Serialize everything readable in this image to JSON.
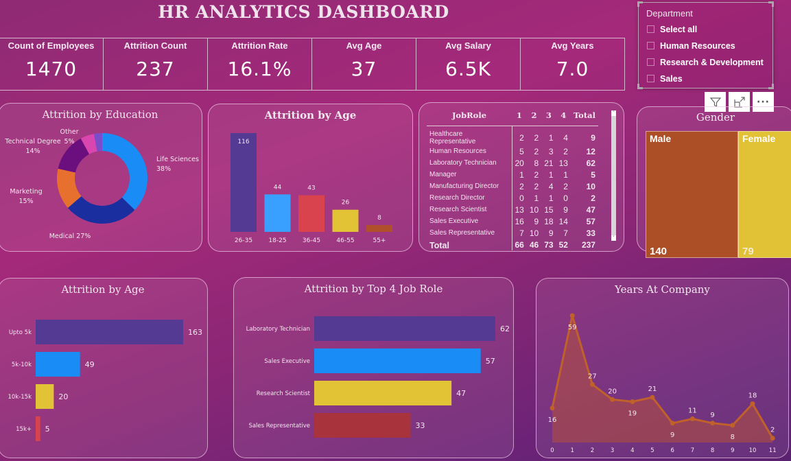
{
  "header": {
    "title": "HR ANALYTICS DASHBOARD"
  },
  "kpis": [
    {
      "label": "Count of Employees",
      "value": "1470"
    },
    {
      "label": "Attrition Count",
      "value": "237"
    },
    {
      "label": "Attrition Rate",
      "value": "16.1%"
    },
    {
      "label": "Avg Age",
      "value": "37"
    },
    {
      "label": "Avg Salary",
      "value": "6.5K"
    },
    {
      "label": "Avg Years",
      "value": "7.0"
    }
  ],
  "slicer": {
    "title": "Department",
    "options": [
      {
        "label": "Select all",
        "checked": false
      },
      {
        "label": "Human Resources",
        "checked": false
      },
      {
        "label": "Research & Development",
        "checked": false
      },
      {
        "label": "Sales",
        "checked": false
      }
    ],
    "header_icons": [
      "filter-icon",
      "focus-mode-icon",
      "more-options-icon"
    ],
    "more_label": "···"
  },
  "education": {
    "title": "Attrition by Education",
    "chart_data": {
      "type": "pie",
      "title": "Attrition by Education",
      "slices": [
        {
          "label": "Life Sciences",
          "percent": 38,
          "color": "#1a8cf5",
          "display": "Life Sciences\n38%"
        },
        {
          "label": "Medical",
          "percent": 27,
          "color": "#1b2ea0",
          "display": "Medical 27%"
        },
        {
          "label": "Marketing",
          "percent": 15,
          "color": "#e8702f",
          "display": "Marketing\n15%"
        },
        {
          "label": "Technical Degree",
          "percent": 14,
          "color": "#6b0f7f",
          "display": "Technical Degree\n14%"
        },
        {
          "label": "Other",
          "percent": 5,
          "color": "#d946b0",
          "display": "Other\n5%"
        },
        {
          "label": "",
          "percent": 3,
          "color": "#7b4ccc",
          "display": ""
        }
      ]
    }
  },
  "age": {
    "title": "Attrition by Age",
    "chart_data": {
      "type": "bar",
      "title": "Attrition by Age",
      "categories": [
        "26-35",
        "18-25",
        "36-45",
        "46-55",
        "55+"
      ],
      "values": [
        116,
        44,
        43,
        26,
        8
      ],
      "colors": [
        "#553a94",
        "#3aa0ff",
        "#d8434e",
        "#e2c336",
        "#b0502a"
      ]
    }
  },
  "jobrole_table": {
    "headers": [
      "JobRole",
      "1",
      "2",
      "3",
      "4",
      "Total"
    ],
    "rows": [
      [
        "Healthcare Representative",
        "2",
        "2",
        "1",
        "4",
        "9"
      ],
      [
        "Human Resources",
        "5",
        "2",
        "3",
        "2",
        "12"
      ],
      [
        "Laboratory Technician",
        "20",
        "8",
        "21",
        "13",
        "62"
      ],
      [
        "Manager",
        "1",
        "2",
        "1",
        "1",
        "5"
      ],
      [
        "Manufacturing Director",
        "2",
        "2",
        "4",
        "2",
        "10"
      ],
      [
        "Research Director",
        "0",
        "1",
        "1",
        "0",
        "2"
      ],
      [
        "Research Scientist",
        "13",
        "10",
        "15",
        "9",
        "47"
      ],
      [
        "Sales Executive",
        "16",
        "9",
        "18",
        "14",
        "57"
      ],
      [
        "Sales Representative",
        "7",
        "10",
        "9",
        "7",
        "33"
      ]
    ],
    "total": [
      "Total",
      "66",
      "46",
      "73",
      "52",
      "237"
    ]
  },
  "gender": {
    "title": "Gender",
    "chart_data": {
      "type": "treemap",
      "title": "Gender",
      "categories": [
        "Male",
        "Female"
      ],
      "values": [
        140,
        79
      ],
      "colors": [
        "#ad4f26",
        "#e1c135"
      ]
    },
    "items": [
      {
        "label": "Male",
        "value": "140"
      },
      {
        "label": "Female",
        "value": "79"
      }
    ]
  },
  "salary": {
    "title": "Attrition by Age",
    "chart_data": {
      "type": "bar",
      "orientation": "horizontal",
      "title": "Attrition by Age",
      "categories": [
        "Upto 5k",
        "5k-10k",
        "10k-15k",
        "15k+"
      ],
      "values": [
        163,
        49,
        20,
        5
      ],
      "colors": [
        "#553a94",
        "#1a8cf5",
        "#e2c336",
        "#d8434e"
      ]
    }
  },
  "top_roles": {
    "title": "Attrition by Top 4 Job Role",
    "chart_data": {
      "type": "bar",
      "orientation": "horizontal",
      "title": "Attrition by Top 4 Job Role",
      "categories": [
        "Laboratory Technician",
        "Sales Executive",
        "Research Scientist",
        "Sales Representative"
      ],
      "values": [
        62,
        57,
        47,
        33
      ],
      "colors": [
        "#553a94",
        "#1a8cf5",
        "#e2c336",
        "#a9333c"
      ]
    }
  },
  "years": {
    "title": "Years At Company",
    "chart_data": {
      "type": "area",
      "title": "Years At Company",
      "x": [
        0,
        1,
        2,
        3,
        4,
        5,
        6,
        7,
        8,
        9,
        10,
        11
      ],
      "values": [
        16,
        59,
        27,
        20,
        19,
        21,
        9,
        11,
        9,
        8,
        18,
        2
      ],
      "label_below": [
        true,
        true,
        false,
        false,
        true,
        false,
        true,
        false,
        false,
        true,
        false,
        false
      ],
      "color": "#c0602a",
      "ylim": [
        0,
        60
      ]
    }
  }
}
